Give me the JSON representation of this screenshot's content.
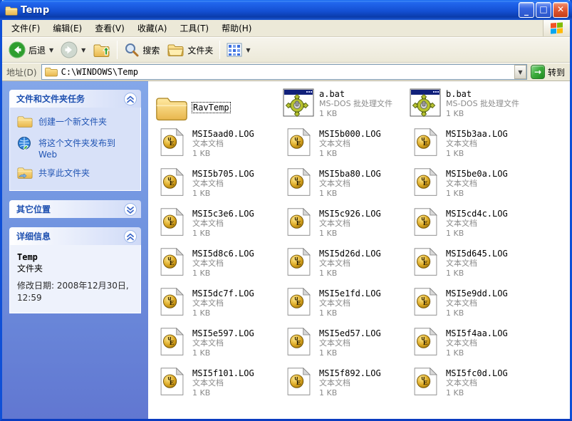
{
  "window": {
    "title": "Temp"
  },
  "titlebar_buttons": {
    "minimize": "_",
    "maximize": "□",
    "close": "✕"
  },
  "menu": {
    "items": [
      "文件(F)",
      "编辑(E)",
      "查看(V)",
      "收藏(A)",
      "工具(T)",
      "帮助(H)"
    ]
  },
  "toolbar": {
    "back_label": "后退",
    "search_label": "搜索",
    "folders_label": "文件夹"
  },
  "address": {
    "label": "地址(D)",
    "value": "C:\\WINDOWS\\Temp",
    "go_label": "转到"
  },
  "sidebar": {
    "tasks": {
      "title": "文件和文件夹任务",
      "items": [
        {
          "icon": "new-folder-icon",
          "label": "创建一个新文件夹"
        },
        {
          "icon": "publish-web-icon",
          "label": "将这个文件夹发布到 Web"
        },
        {
          "icon": "share-folder-icon",
          "label": "共享此文件夹"
        }
      ]
    },
    "other_places": {
      "title": "其它位置"
    },
    "details": {
      "title": "详细信息",
      "name": "Temp",
      "type": "文件夹",
      "modified_line1": "修改日期: 2008年12月30日,",
      "modified_line2": "12:59"
    }
  },
  "files": [
    {
      "name": "RavTemp",
      "kind": "folder",
      "type_label": "",
      "size": "",
      "focused": true
    },
    {
      "name": "a.bat",
      "kind": "bat",
      "type_label": "MS-DOS 批处理文件",
      "size": "1 KB"
    },
    {
      "name": "b.bat",
      "kind": "bat",
      "type_label": "MS-DOS 批处理文件",
      "size": "1 KB"
    },
    {
      "name": "MSI5aad0.LOG",
      "kind": "log",
      "type_label": "文本文档",
      "size": "1 KB"
    },
    {
      "name": "MSI5b000.LOG",
      "kind": "log",
      "type_label": "文本文档",
      "size": "1 KB"
    },
    {
      "name": "MSI5b3aa.LOG",
      "kind": "log",
      "type_label": "文本文档",
      "size": "1 KB"
    },
    {
      "name": "MSI5b705.LOG",
      "kind": "log",
      "type_label": "文本文档",
      "size": "1 KB"
    },
    {
      "name": "MSI5ba80.LOG",
      "kind": "log",
      "type_label": "文本文档",
      "size": "1 KB"
    },
    {
      "name": "MSI5be0a.LOG",
      "kind": "log",
      "type_label": "文本文档",
      "size": "1 KB"
    },
    {
      "name": "MSI5c3e6.LOG",
      "kind": "log",
      "type_label": "文本文档",
      "size": "1 KB"
    },
    {
      "name": "MSI5c926.LOG",
      "kind": "log",
      "type_label": "文本文档",
      "size": "1 KB"
    },
    {
      "name": "MSI5cd4c.LOG",
      "kind": "log",
      "type_label": "文本文档",
      "size": "1 KB"
    },
    {
      "name": "MSI5d8c6.LOG",
      "kind": "log",
      "type_label": "文本文档",
      "size": "1 KB"
    },
    {
      "name": "MSI5d26d.LOG",
      "kind": "log",
      "type_label": "文本文档",
      "size": "1 KB"
    },
    {
      "name": "MSI5d645.LOG",
      "kind": "log",
      "type_label": "文本文档",
      "size": "1 KB"
    },
    {
      "name": "MSI5dc7f.LOG",
      "kind": "log",
      "type_label": "文本文档",
      "size": "1 KB"
    },
    {
      "name": "MSI5e1fd.LOG",
      "kind": "log",
      "type_label": "文本文档",
      "size": "1 KB"
    },
    {
      "name": "MSI5e9dd.LOG",
      "kind": "log",
      "type_label": "文本文档",
      "size": "1 KB"
    },
    {
      "name": "MSI5e597.LOG",
      "kind": "log",
      "type_label": "文本文档",
      "size": "1 KB"
    },
    {
      "name": "MSI5ed57.LOG",
      "kind": "log",
      "type_label": "文本文档",
      "size": "1 KB"
    },
    {
      "name": "MSI5f4aa.LOG",
      "kind": "log",
      "type_label": "文本文档",
      "size": "1 KB"
    },
    {
      "name": "MSI5f101.LOG",
      "kind": "log",
      "type_label": "文本文档",
      "size": "1 KB"
    },
    {
      "name": "MSI5f892.LOG",
      "kind": "log",
      "type_label": "文本文档",
      "size": "1 KB"
    },
    {
      "name": "MSI5fc0d.LOG",
      "kind": "log",
      "type_label": "文本文档",
      "size": "1 KB"
    }
  ],
  "colors": {
    "titlebar_blue": "#1450d4",
    "sidebar_top": "#84a7e9",
    "sidebar_bottom": "#6177d1",
    "panel_header_text": "#1e50b0",
    "task_link": "#2155b4",
    "go_green": "#3fae3f"
  }
}
